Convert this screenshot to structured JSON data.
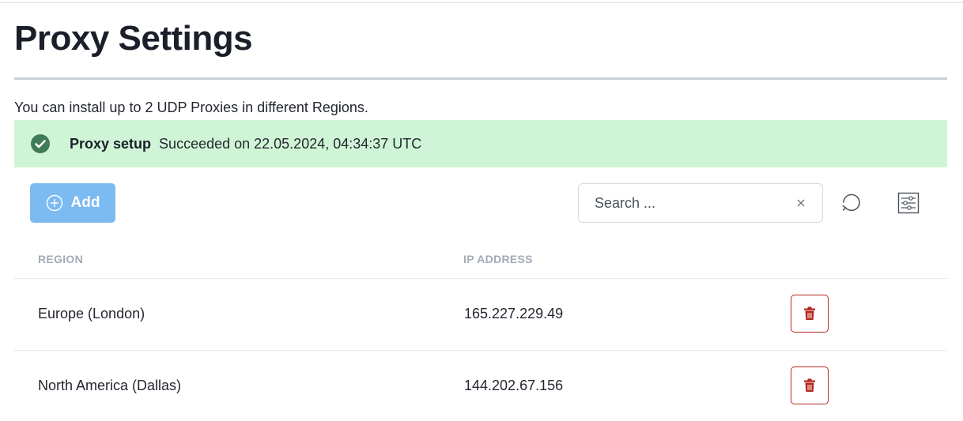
{
  "page": {
    "title": "Proxy Settings",
    "description": "You can install up to 2 UDP Proxies in different Regions."
  },
  "status_banner": {
    "label": "Proxy setup",
    "message": "Succeeded on 22.05.2024, 04:34:37 UTC",
    "icon": "check-circle-icon",
    "color": "#d0f5d6"
  },
  "toolbar": {
    "add_label": "Add",
    "search_placeholder": "Search ...",
    "search_value": "",
    "refresh_icon": "refresh-icon",
    "filter_icon": "filter-settings-icon"
  },
  "table": {
    "columns": [
      "REGION",
      "IP ADDRESS"
    ],
    "rows": [
      {
        "region": "Europe (London)",
        "ip": "165.227.229.49"
      },
      {
        "region": "North America (Dallas)",
        "ip": "144.202.67.156"
      }
    ]
  },
  "colors": {
    "accent": "#7cbaf2",
    "success": "#3f7b54",
    "danger": "#b3261e"
  }
}
